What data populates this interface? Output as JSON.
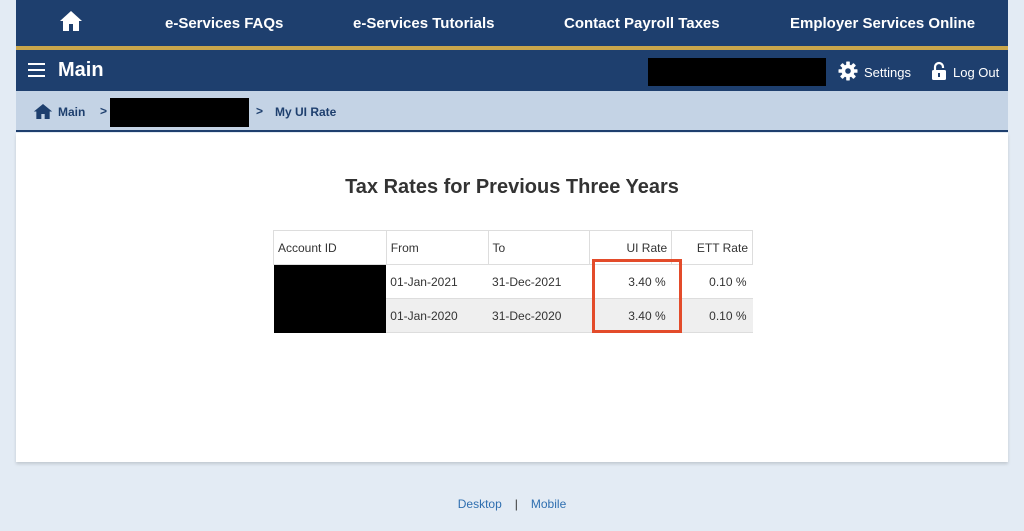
{
  "topnav": {
    "home_icon": "home-icon",
    "links": [
      "e-Services FAQs",
      "e-Services Tutorials",
      "Contact Payroll Taxes",
      "Employer Services Online"
    ]
  },
  "mainbar": {
    "title": "Main",
    "settings_label": "Settings",
    "logout_label": "Log Out"
  },
  "breadcrumb": {
    "home_label": "Main",
    "current_label": "My UI Rate",
    "separator": ">"
  },
  "main": {
    "title": "Tax Rates for Previous Three Years",
    "table": {
      "headers": [
        "Account ID",
        "From",
        "To",
        "UI Rate",
        "ETT Rate"
      ],
      "rows": [
        {
          "from": "01-Jan-2021",
          "to": "31-Dec-2021",
          "ui_rate": "3.40 %",
          "ett_rate": "0.10 %"
        },
        {
          "from": "01-Jan-2020",
          "to": "31-Dec-2020",
          "ui_rate": "3.40 %",
          "ett_rate": "0.10 %"
        }
      ]
    }
  },
  "footer": {
    "desktop_label": "Desktop",
    "separator": "|",
    "mobile_label": "Mobile"
  },
  "colors": {
    "nav_bg": "#1e3f6e",
    "gold_accent": "#c9a64b",
    "breadcrumb_bg": "#c4d3e5",
    "highlight_border": "#e34b2a",
    "link": "#2f6fb0"
  }
}
